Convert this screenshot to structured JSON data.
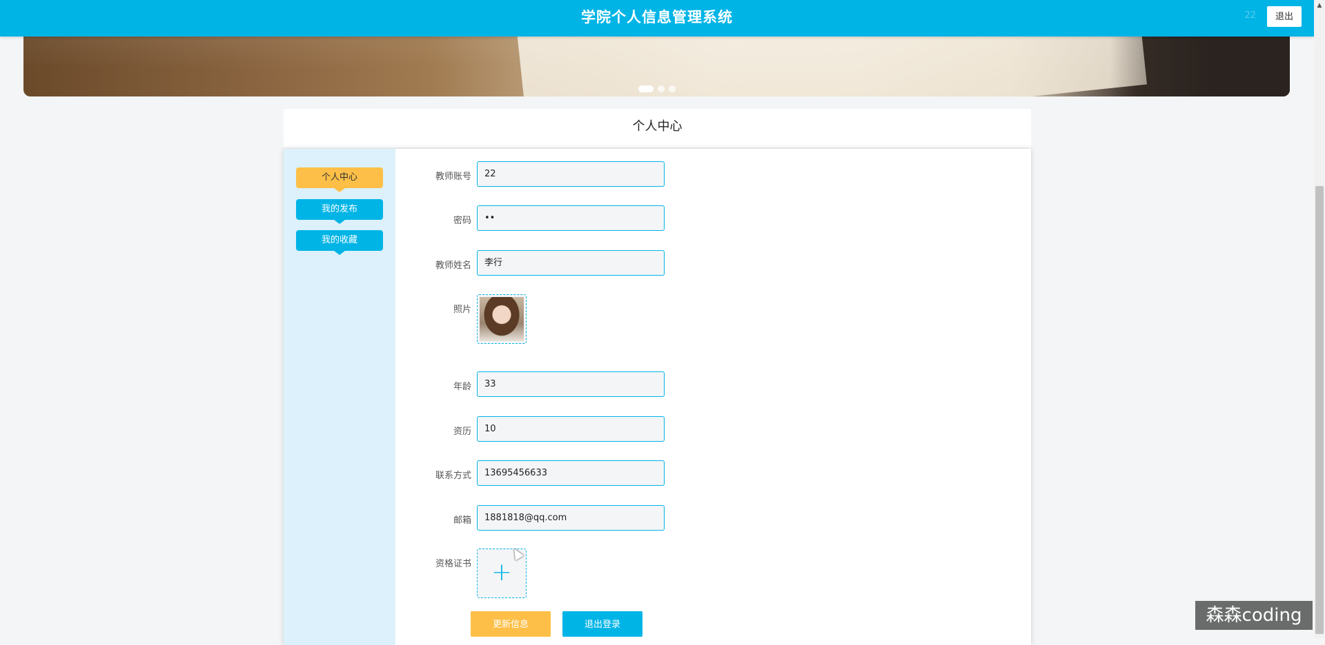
{
  "header": {
    "title": "学院个人信息管理系统",
    "username": "22",
    "logout_label": "退出"
  },
  "banner": {
    "slide_count": 3,
    "active_slide": 1
  },
  "section": {
    "title": "个人中心"
  },
  "sidebar": {
    "items": [
      {
        "label": "个人中心",
        "active": true
      },
      {
        "label": "我的发布",
        "active": false
      },
      {
        "label": "我的收藏",
        "active": false
      }
    ]
  },
  "form": {
    "teacher_account": {
      "label": "教师账号",
      "value": "22"
    },
    "password": {
      "label": "密码",
      "value": "••"
    },
    "teacher_name": {
      "label": "教师姓名",
      "value": "李行"
    },
    "photo": {
      "label": "照片"
    },
    "age": {
      "label": "年龄",
      "value": "33"
    },
    "seniority": {
      "label": "资历",
      "value": "10"
    },
    "contact": {
      "label": "联系方式",
      "value": "13695456633"
    },
    "email": {
      "label": "邮箱",
      "value": "1881818@qq.com"
    },
    "certificate": {
      "label": "资格证书"
    }
  },
  "actions": {
    "update_label": "更新信息",
    "signout_label": "退出登录"
  },
  "watermark": "森森coding",
  "colors": {
    "primary": "#00b4e6",
    "accent": "#fdbf47",
    "sidebar_bg": "#dcf1fb"
  }
}
